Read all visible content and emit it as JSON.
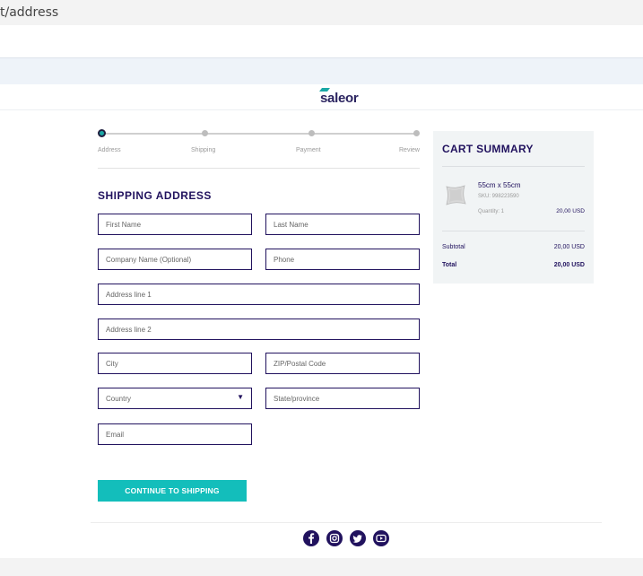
{
  "browser": {
    "url_fragment": "t/address"
  },
  "brand": {
    "logo_text": "saleor"
  },
  "progress": {
    "steps": [
      "Address",
      "Shipping",
      "Payment",
      "Review"
    ],
    "current_step": "Address"
  },
  "form": {
    "title": "SHIPPING ADDRESS",
    "fields": {
      "first_name": "First Name",
      "last_name": "Last Name",
      "company": "Company Name (Optional)",
      "phone": "Phone",
      "address1": "Address line 1",
      "address2": "Address line 2",
      "city": "City",
      "zip": "ZIP/Postal Code",
      "country": "Country",
      "state": "State/province",
      "email": "Email"
    },
    "submit_label": "CONTINUE TO SHIPPING"
  },
  "cart": {
    "title": "CART SUMMARY",
    "item": {
      "name": "55cm x 55cm",
      "sku": "SKU: 998223590",
      "quantity": "Quantity: 1",
      "price": "20,00 USD"
    },
    "subtotal_label": "Subtotal",
    "subtotal_value": "20,00 USD",
    "total_label": "Total",
    "total_value": "20,00 USD"
  },
  "footer": {
    "social_icons": [
      "facebook-icon",
      "instagram-icon",
      "twitter-icon",
      "youtube-icon"
    ]
  },
  "colors": {
    "primary": "#21125e",
    "accent": "#13bebb",
    "cart_bg": "#f1f4f5"
  }
}
